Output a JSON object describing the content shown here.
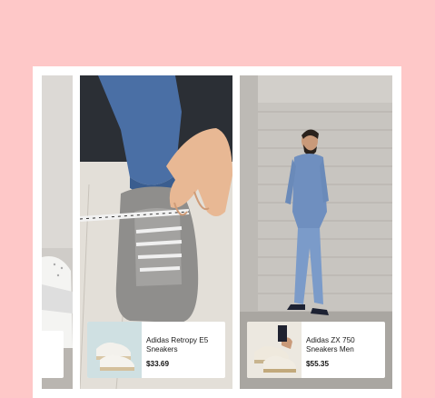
{
  "products": [
    {
      "name": "Adidas Retropy E5 Sneakers",
      "price": "$33.69"
    },
    {
      "name": "Adidas ZX 750 Sneakers Men",
      "price": "$55.35"
    }
  ]
}
